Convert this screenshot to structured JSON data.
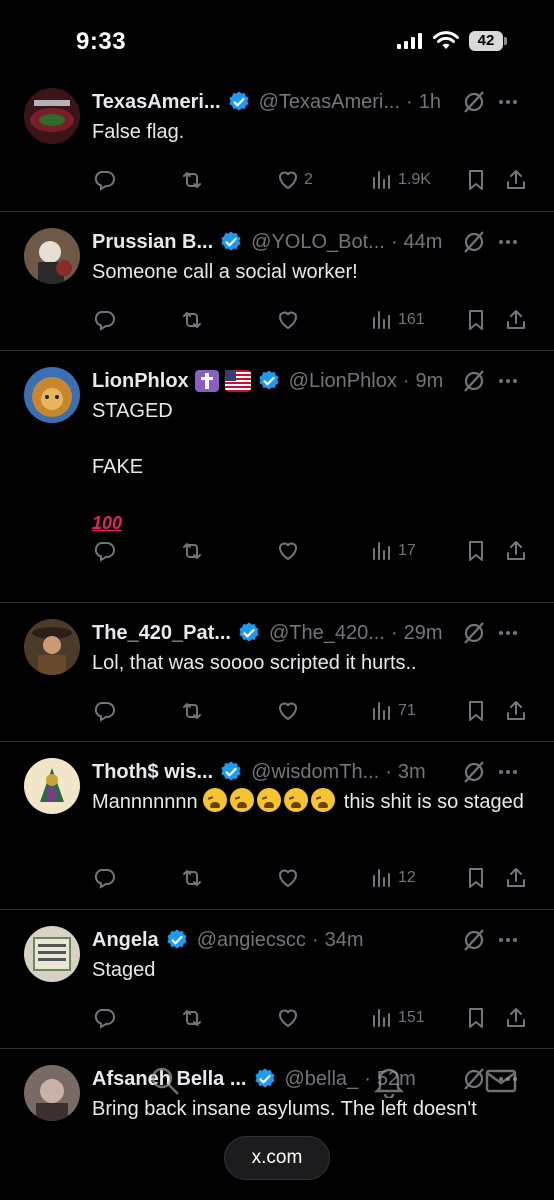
{
  "status_bar": {
    "time": "9:33",
    "battery": "42"
  },
  "posts": [
    {
      "name": "TexasAmeri...",
      "handle": "@TexasAmeri...",
      "time": "1h",
      "text": "False flag.",
      "replies": "",
      "reposts": "",
      "likes": "2",
      "views": "1.9K"
    },
    {
      "name": "Prussian B...",
      "handle": "@YOLO_Bot...",
      "time": "44m",
      "text": "Someone call a social worker!",
      "replies": "",
      "reposts": "",
      "likes": "",
      "views": "161"
    },
    {
      "name": "LionPhlox",
      "handle": "@LionPhlox",
      "time": "9m",
      "text": "STAGED\n\nFAKE\n\n",
      "emoji_text": "100",
      "replies": "",
      "reposts": "",
      "likes": "",
      "views": "17"
    },
    {
      "name": "The_420_Pat...",
      "handle": "@The_420...",
      "time": "29m",
      "text": "Lol, that was soooo scripted it hurts..",
      "replies": "",
      "reposts": "",
      "likes": "",
      "views": "71"
    },
    {
      "name": "Thoth$ wis...",
      "handle": "@wisdomTh...",
      "time": "3m",
      "text_before": "Mannnnnnn ",
      "text_after": " this shit is so staged",
      "replies": "",
      "reposts": "",
      "likes": "",
      "views": "12"
    },
    {
      "name": "Angela",
      "handle": "@angiecscc",
      "time": "34m",
      "text": "Staged",
      "replies": "",
      "reposts": "",
      "likes": "",
      "views": "151"
    },
    {
      "name": "Afsaneh Bella ...",
      "handle": "@bella_",
      "time": "52m",
      "text": "Bring back insane asylums. The left doesn't"
    }
  ],
  "browser": {
    "url": "x.com"
  },
  "colors": {
    "background": "#000000",
    "text": "#e7e9ea",
    "muted": "#71767b",
    "verified": "#1d9bf0",
    "divider": "#2f3336"
  }
}
